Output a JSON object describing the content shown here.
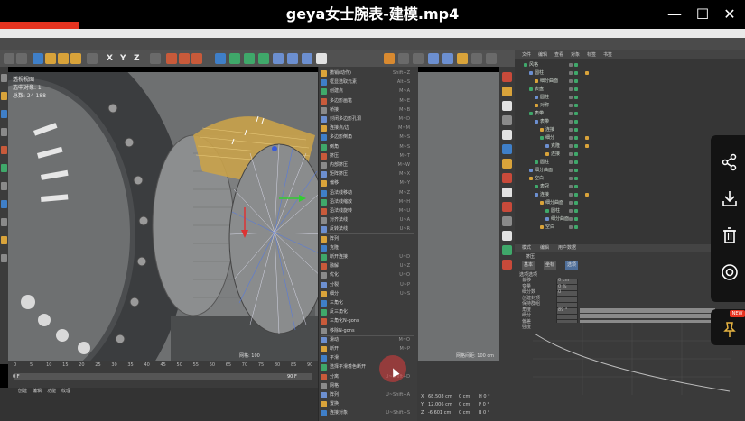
{
  "window": {
    "title": "geya女士腕表-建模.mp4",
    "controls": [
      "minimize-icon",
      "maximize-icon",
      "close-icon"
    ]
  },
  "viewport": {
    "hud": [
      "透视视图",
      "选中对象: 1",
      "总数: 24  188"
    ],
    "bottom_label": "网格: 100"
  },
  "viewport2": {
    "bottom_label": "网格间距: 100 cm"
  },
  "context_menu": {
    "items": [
      {
        "label": "撤销(动作)",
        "shortcut": "Shift+Z"
      },
      {
        "label": "框显选取元素",
        "shortcut": "Alt+S"
      },
      {
        "label": "创建点",
        "shortcut": "M~A"
      },
      {
        "label": "多边形画笔",
        "shortcut": "M~E"
      },
      {
        "label": "桥接",
        "shortcut": "M~B"
      },
      {
        "label": "封闭多边形孔洞",
        "shortcut": "M~D"
      },
      {
        "label": "连接点/边",
        "shortcut": "M~M"
      },
      {
        "label": "多边形倒角",
        "shortcut": "M~S"
      },
      {
        "label": "倒角",
        "shortcut": "M~S"
      },
      {
        "label": "挤压",
        "shortcut": "M~T"
      },
      {
        "label": "内部挤压",
        "shortcut": "M~W"
      },
      {
        "label": "矩阵挤压",
        "shortcut": "M~X"
      },
      {
        "label": "偏移",
        "shortcut": "M~Y"
      },
      {
        "label": "沿法线移动",
        "shortcut": "M~Z"
      },
      {
        "label": "沿法线缩放",
        "shortcut": "M~H"
      },
      {
        "label": "沿法线旋转",
        "shortcut": "M~U"
      },
      {
        "label": "对齐法线",
        "shortcut": "U~A"
      },
      {
        "label": "反转法线",
        "shortcut": "U~R"
      },
      {
        "label": "阵列",
        "shortcut": ""
      },
      {
        "label": "克隆",
        "shortcut": ""
      },
      {
        "label": "断开连接",
        "shortcut": "U~D"
      },
      {
        "label": "融解",
        "shortcut": "U~Z"
      },
      {
        "label": "优化",
        "shortcut": "U~O"
      },
      {
        "label": "分裂",
        "shortcut": "U~P"
      },
      {
        "label": "细分",
        "shortcut": "U~S"
      },
      {
        "label": "三角化",
        "shortcut": ""
      },
      {
        "label": "反三角化",
        "shortcut": ""
      },
      {
        "label": "三角化N-gons",
        "shortcut": ""
      },
      {
        "label": "移除N-gons",
        "shortcut": ""
      },
      {
        "label": "滑动",
        "shortcut": "M~O"
      },
      {
        "label": "断开",
        "shortcut": "M~P"
      },
      {
        "label": "平滑",
        "shortcut": ""
      },
      {
        "label": "选择平滑着色断开",
        "shortcut": ""
      },
      {
        "label": "分离",
        "shortcut": "U~Shift+D"
      },
      {
        "label": "网格",
        "shortcut": ""
      },
      {
        "label": "阵列",
        "shortcut": "U~Shift+A"
      },
      {
        "label": "置换",
        "shortcut": ""
      },
      {
        "label": "连接对象",
        "shortcut": "U~Shift+S"
      }
    ]
  },
  "object_manager": {
    "menu": [
      "文件",
      "编辑",
      "查看",
      "对象",
      "标签",
      "书签"
    ],
    "rows": [
      "风格",
      "圆柱",
      "细分曲面",
      "表盘",
      "圆柱",
      "对称",
      "表带",
      "表带",
      "连接",
      "细分",
      "克隆",
      "连接",
      "圆柱",
      "细分曲面",
      "空白",
      "表冠",
      "连接",
      "细分曲面",
      "圆柱",
      "细分曲面",
      "空白"
    ]
  },
  "attribute_manager": {
    "menu": [
      "模式",
      "编辑",
      "用户数据"
    ],
    "object_label": "挤压",
    "tabs": [
      "基本",
      "坐标",
      "选项"
    ],
    "active_tab": "选项",
    "header": "选项选项",
    "rows": [
      "偏移",
      "变量",
      "细分数",
      "创建封顶",
      "保持群组",
      "角度",
      "细分",
      "偏差",
      "强度"
    ],
    "values": [
      "0 cm",
      "0 %",
      "0",
      "",
      "",
      "89 °",
      "",
      "",
      ""
    ]
  },
  "timeline": {
    "ticks": [
      "0",
      "5",
      "10",
      "15",
      "20",
      "25",
      "30",
      "35",
      "40",
      "45",
      "50",
      "55",
      "60",
      "65",
      "70",
      "75",
      "80",
      "85",
      "90"
    ],
    "start": "0 F",
    "end": "90 F",
    "bottom_menu": [
      "创建",
      "编辑",
      "功能",
      "纹理"
    ]
  },
  "coordinates": {
    "rows": [
      {
        "axis": "X",
        "pos": "68.508 cm",
        "size": "0 cm",
        "rot": "H 0 °"
      },
      {
        "axis": "Y",
        "pos": "12.006 cm",
        "size": "0 cm",
        "rot": "P 0 °"
      },
      {
        "axis": "Z",
        "pos": "-6.601 cm",
        "size": "0 cm",
        "rot": "B 0 °"
      }
    ]
  },
  "side_panel": {
    "icons": [
      "share-icon",
      "download-icon",
      "trash-icon",
      "visibility-icon",
      "pin-icon"
    ],
    "new_badge": "NEW"
  },
  "colors": {
    "accent_red": "#e53320",
    "panel_dark": "#3a3a3a",
    "viewport_gray": "#6c6e6f",
    "selected_face": "#c9a24a"
  }
}
